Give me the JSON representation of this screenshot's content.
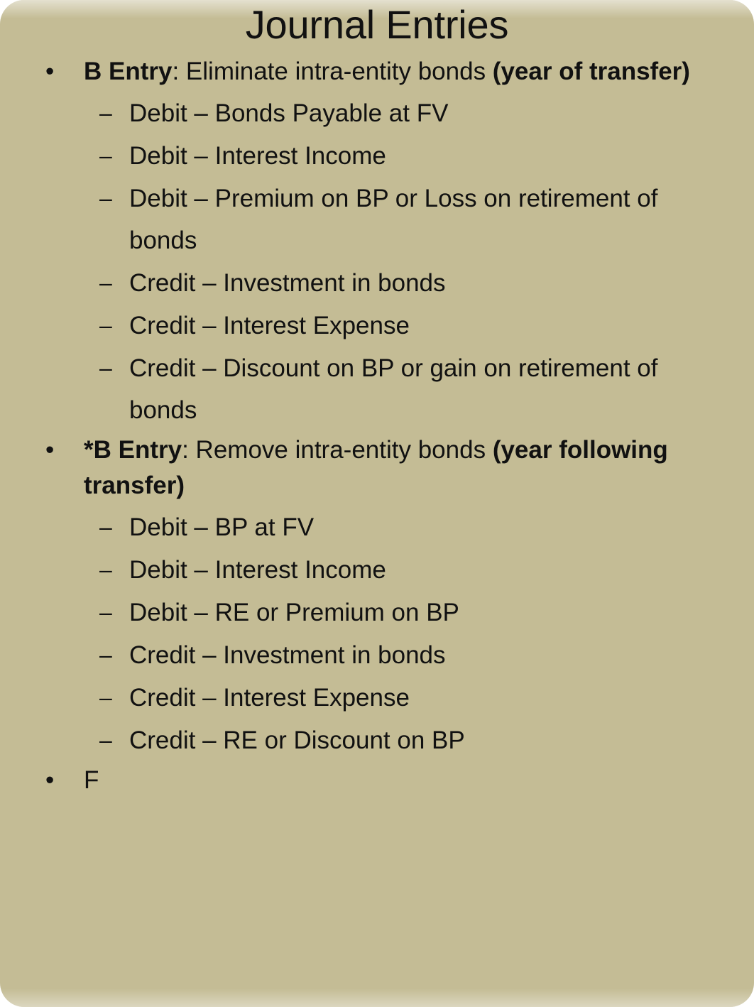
{
  "slide": {
    "title": "Journal Entries",
    "background_color": "#C4BC95",
    "text_color": "#111111",
    "bullet_glyph_level1": "•",
    "bullet_glyph_level2": "–"
  },
  "content": {
    "groups": [
      {
        "heading": {
          "lead_bold": "B Entry",
          "middle_regular": ": Eliminate intra-entity bonds ",
          "trail_bold": "(year of transfer)",
          "full_text": "B Entry: Eliminate intra-entity bonds (year of transfer)"
        },
        "items": [
          "Debit – Bonds Payable at FV",
          "Debit – Interest Income",
          "Debit – Premium on BP or Loss on retirement of bonds",
          "Credit – Investment in bonds",
          "Credit – Interest Expense",
          "Credit – Discount on BP or gain on retirement of bonds"
        ]
      },
      {
        "heading": {
          "lead_bold": "*B Entry",
          "middle_regular": ": Remove intra-entity bonds ",
          "trail_bold": "(year following transfer)",
          "full_text": "*B Entry: Remove intra-entity bonds (year following transfer)"
        },
        "items": [
          "Debit – BP at FV",
          "Debit – Interest Income",
          "Debit – RE or Premium on BP",
          "Credit – Investment in bonds",
          "Credit – Interest Expense",
          "Credit – RE or Discount on BP"
        ]
      },
      {
        "heading": {
          "lead_bold": "",
          "middle_regular": "F",
          "trail_bold": "",
          "full_text": "F"
        },
        "items": []
      }
    ]
  }
}
